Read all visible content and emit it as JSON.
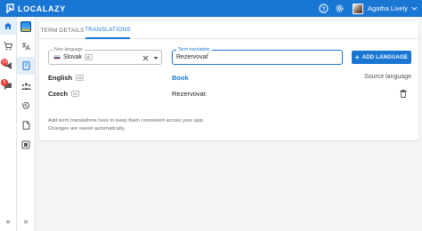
{
  "app": {
    "name": "LOCALAZY"
  },
  "topbar": {
    "help_icon": "help-circle-icon",
    "settings_icon": "gear-icon",
    "user_name": "Agatha Lively"
  },
  "nav_primary": {
    "items": [
      {
        "name": "home",
        "icon": "home-icon",
        "active": true
      },
      {
        "name": "store",
        "icon": "cart-icon"
      },
      {
        "name": "notifications",
        "icon": "megaphone-icon",
        "badge": "10"
      },
      {
        "name": "messages",
        "icon": "chat-icon",
        "badge": "5"
      }
    ],
    "collapse": "»"
  },
  "nav_project": {
    "items": [
      {
        "name": "project",
        "icon": "project-thumb"
      },
      {
        "name": "translate",
        "icon": "translate-icon"
      },
      {
        "name": "glossary",
        "icon": "book-icon",
        "active": true
      },
      {
        "name": "team",
        "icon": "people-icon"
      },
      {
        "name": "history",
        "icon": "history-icon"
      },
      {
        "name": "file",
        "icon": "file-icon"
      },
      {
        "name": "screenshots",
        "icon": "image-icon"
      }
    ],
    "collapse": "»"
  },
  "tabs": [
    {
      "label": "TERM DETAILS",
      "active": false
    },
    {
      "label": "TRANSLATIONS",
      "active": true
    }
  ],
  "new_language": {
    "label": "New language",
    "value": "Slovak",
    "code": "sk"
  },
  "term_translation": {
    "label": "Term translation",
    "value": "Rezervovať"
  },
  "add_language_button": "ADD LANGUAGE",
  "rows": [
    {
      "language": "English",
      "code": "en",
      "text": "Book",
      "note": "Source language"
    },
    {
      "language": "Czech",
      "code": "cs",
      "text": "Rezervovat"
    }
  ],
  "help_text": [
    "Add term translations here to keep them consistent across your app.",
    "Changes are saved automatically."
  ],
  "colors": {
    "primary": "#1976d2",
    "badge": "#e53935"
  }
}
